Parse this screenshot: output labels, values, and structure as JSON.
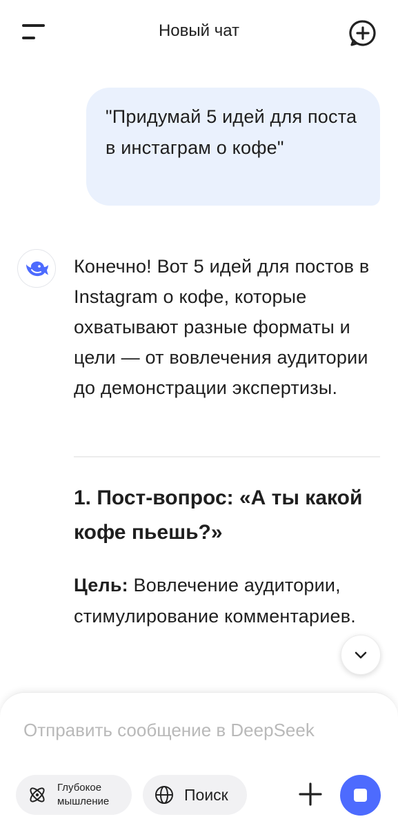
{
  "header": {
    "title": "Новый чат",
    "menu_icon": "menu-icon",
    "new_chat_icon": "new-chat-plus-icon"
  },
  "user_message": "\"Придумай 5 идей для поста в инстаграм о кофе\"",
  "assistant": {
    "avatar_icon": "deepseek-whale-icon",
    "intro": "Конечно! Вот 5 идей для постов в Instagram о кофе, которые охватывают разные форматы и цели — от вовлечения аудитории до демонстрации экспертизы.",
    "heading": "1. Пост-вопрос: «А ты какой кофе пьешь?»",
    "goal_label": "Цель:",
    "goal_text": " Вовлечение аудитории, стимулирование комментариев."
  },
  "composer": {
    "placeholder": "Отправить сообщение в DeepSeek",
    "deep_thinking_label": "Глубокое мышление",
    "search_label": "Поиск",
    "icons": [
      "atom-icon",
      "globe-icon",
      "plus-icon",
      "stop-icon"
    ]
  },
  "colors": {
    "accent": "#4d6bfe",
    "user_bubble": "#eaf1fd",
    "pill_bg": "#f1f1f3"
  }
}
